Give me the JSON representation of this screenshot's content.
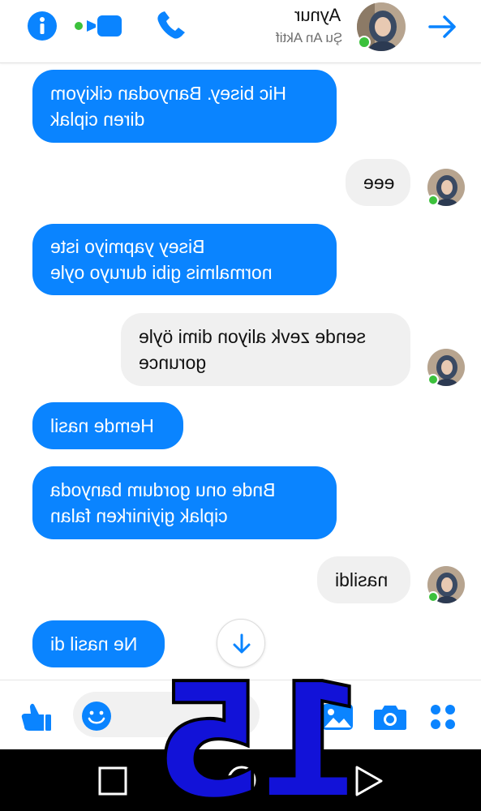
{
  "header": {
    "contact_name": "Aynur",
    "status": "Şu An Aktif"
  },
  "messages": [
    {
      "from": "contact_name_side",
      "side": "left",
      "text": "Hic bisey. Banyodan cikiyom\ndiren ciplak"
    },
    {
      "side": "right",
      "text": "eee"
    },
    {
      "side": "left",
      "text": "Bisey yapmiyo iste\nnormalmis gibi duruyo oyle"
    },
    {
      "side": "right",
      "text": "sende zevk aliyon dimi öyle\ngorunce"
    },
    {
      "side": "left",
      "text": "Hemde nasil"
    },
    {
      "side": "left",
      "text": "Bnde onu gordum banyoda\nciplak giyinirken falan"
    },
    {
      "side": "right",
      "text": "nasildi"
    },
    {
      "side": "left",
      "text": "Ne nasil di"
    }
  ],
  "overlay_number": "15",
  "colors": {
    "accent": "#0a84ff",
    "online": "#3cc13c",
    "incoming_bubble": "#f0f0f0",
    "overlay": "#1212d8"
  },
  "icons": {
    "header": [
      "info-icon",
      "video-call-icon",
      "phone-icon",
      "back-arrow-icon"
    ],
    "composer": [
      "thumbs-up-icon",
      "emoji-icon",
      "gallery-icon",
      "camera-icon",
      "more-icon"
    ],
    "nav": [
      "recent-apps-icon",
      "home-icon",
      "back-triangle-icon"
    ]
  }
}
